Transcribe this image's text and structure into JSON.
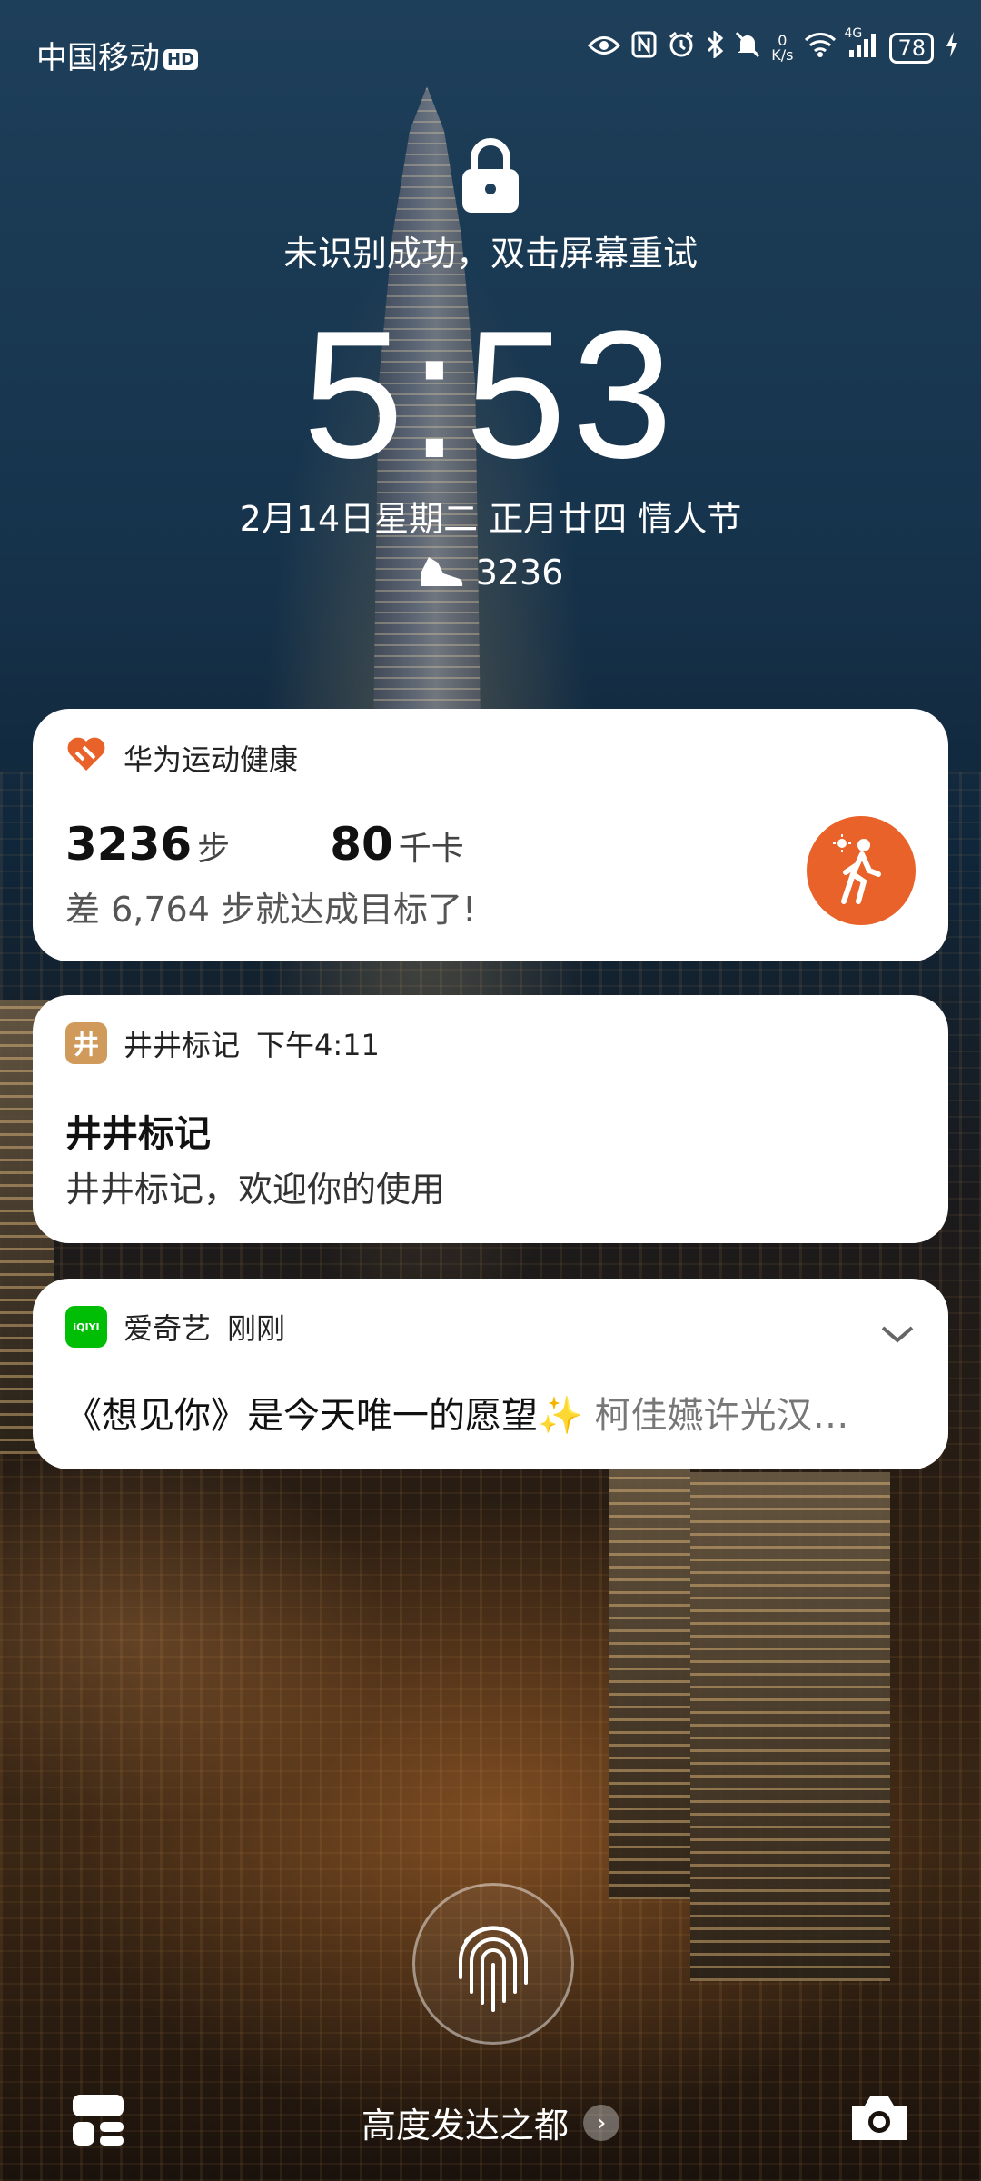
{
  "status_bar": {
    "carrier": "中国移动",
    "hd_badge": "HD",
    "net_speed_value": "0",
    "net_speed_unit": "K/s",
    "signal_type": "4G",
    "battery": "78"
  },
  "lockscreen": {
    "unlock_message": "未识别成功，双击屏幕重试",
    "time": "5:53",
    "date": "2月14日星期二  正月廿四  情人节",
    "steps": "3236"
  },
  "notifications": [
    {
      "app": "华为运动健康",
      "steps_value": "3236",
      "steps_unit": "步",
      "cal_value": "80",
      "cal_unit": "千卡",
      "message": "差 6,764 步就达成目标了!"
    },
    {
      "app": "井井标记",
      "app_icon_char": "井",
      "time": "下午4:11",
      "title": "井井标记",
      "body": "井井标记，欢迎你的使用"
    },
    {
      "app": "爱奇艺",
      "app_icon_text": "iQIYI",
      "time": "刚刚",
      "body_main": "《想见你》是今天唯一的愿望✨",
      "body_rest": " 柯佳嬿许光汉…"
    }
  ],
  "bottom": {
    "slogan": "高度发达之都",
    "arrow": "›"
  },
  "colors": {
    "health_accent": "#e8622a",
    "jingjing_icon": "#d09a5a",
    "iqiyi_icon": "#00be06"
  }
}
